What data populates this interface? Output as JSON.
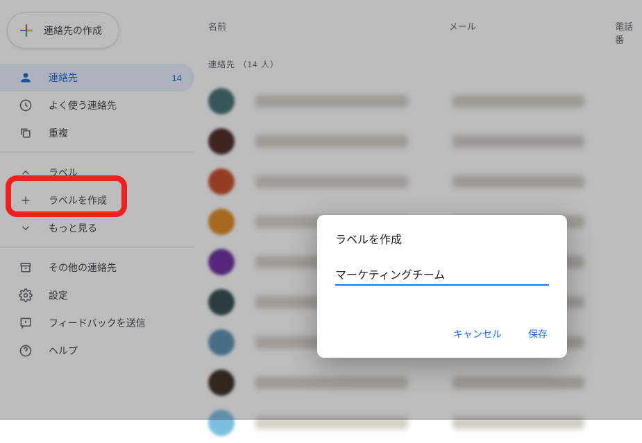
{
  "sidebar": {
    "create_label": "連絡先の作成",
    "items": [
      {
        "label": "連絡先",
        "count": "14"
      },
      {
        "label": "よく使う連絡先"
      },
      {
        "label": "重複"
      }
    ],
    "label_section_header": "ラベル",
    "create_label_label": "ラベルを作成",
    "more_label": "もっと見る",
    "other_contacts_label": "その他の連絡先",
    "settings_label": "設定",
    "feedback_label": "フィードバックを送信",
    "help_label": "ヘルプ"
  },
  "columns": {
    "name": "名前",
    "mail": "メール",
    "phone": "電話番"
  },
  "list_heading_prefix": "連絡先",
  "list_heading_count": "（14 人）",
  "rows": [
    {
      "avatar_color": "#3f6f6f",
      "name_bg": "#d5d1c7",
      "mail_bg": "#d3cfc4"
    },
    {
      "avatar_color": "#4a2620",
      "name_bg": "#d4d0c6",
      "mail_bg": "#d2cec3"
    },
    {
      "avatar_color": "#c84a24",
      "name_bg": "#d6d2c8",
      "mail_bg": "#d2cec4"
    },
    {
      "avatar_color": "#e08a1e",
      "name_bg": "#d7d3c8",
      "mail_bg": "#d1cdc3"
    },
    {
      "avatar_color": "#6b2aa0",
      "name_bg": "#d5d1c6",
      "mail_bg": "#d0ccc2"
    },
    {
      "avatar_color": "#2d4a4a",
      "name_bg": "#d4d0c6",
      "mail_bg": "#d2cec4"
    },
    {
      "avatar_color": "#5a8fb0",
      "name_bg": "#d5d1c7",
      "mail_bg": "#d1cdc3"
    },
    {
      "avatar_color": "#3a2a1c",
      "name_bg": "#d4d0c6",
      "mail_bg": "#cfccc2"
    },
    {
      "avatar_color": "#7bbfe0",
      "name_bg": "#d5d1c6",
      "mail_bg": "#d0cdc3"
    }
  ],
  "dialog": {
    "title": "ラベルを作成",
    "input_value": "マーケティングチーム",
    "cancel": "キャンセル",
    "save": "保存"
  },
  "colors": {
    "accent": "#1a73e8"
  }
}
